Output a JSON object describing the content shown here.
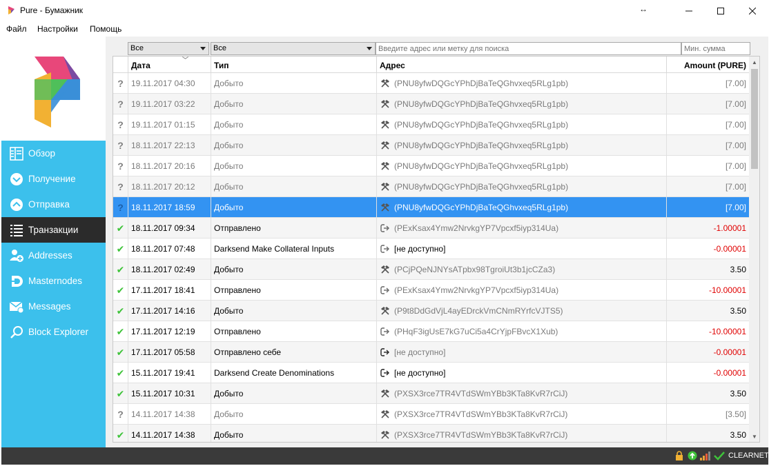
{
  "window": {
    "title": "Pure - Бумажник"
  },
  "menu": [
    "Файл",
    "Настройки",
    "Помощь"
  ],
  "sidebar": {
    "items": [
      {
        "label": "Обзор",
        "icon": "overview-icon",
        "active": false
      },
      {
        "label": "Получение",
        "icon": "receive-icon",
        "active": false
      },
      {
        "label": "Отправка",
        "icon": "send-icon",
        "active": false
      },
      {
        "label": "Транзакции",
        "icon": "transactions-icon",
        "active": true
      },
      {
        "label": "Addresses",
        "icon": "addresses-icon",
        "active": false
      },
      {
        "label": "Masternodes",
        "icon": "masternodes-icon",
        "active": false
      },
      {
        "label": "Messages",
        "icon": "messages-icon",
        "active": false
      },
      {
        "label": "Block Explorer",
        "icon": "block-explorer-icon",
        "active": false
      }
    ]
  },
  "filters": {
    "date_value": "Все",
    "type_value": "Все",
    "search_placeholder": "Введите адрес или метку для поиска",
    "min_amount_placeholder": "Мин. сумма"
  },
  "table": {
    "headers": {
      "date": "Дата",
      "type": "Тип",
      "address": "Адрес",
      "amount": "Amount (PURE)"
    },
    "rows": [
      {
        "status": "?",
        "date": "19.11.2017 04:30",
        "type": "Добыто",
        "addr_icon": "mined",
        "address": "(PNU8yfwDQGcYPhDjBaTeQGhvxeq5RLg1pb)",
        "amount": "[7.00]",
        "style": "immature"
      },
      {
        "status": "?",
        "date": "19.11.2017 03:22",
        "type": "Добыто",
        "addr_icon": "mined",
        "address": "(PNU8yfwDQGcYPhDjBaTeQGhvxeq5RLg1pb)",
        "amount": "[7.00]",
        "style": "immature"
      },
      {
        "status": "?",
        "date": "19.11.2017 01:15",
        "type": "Добыто",
        "addr_icon": "mined",
        "address": "(PNU8yfwDQGcYPhDjBaTeQGhvxeq5RLg1pb)",
        "amount": "[7.00]",
        "style": "immature"
      },
      {
        "status": "?",
        "date": "18.11.2017 22:13",
        "type": "Добыто",
        "addr_icon": "mined",
        "address": "(PNU8yfwDQGcYPhDjBaTeQGhvxeq5RLg1pb)",
        "amount": "[7.00]",
        "style": "immature"
      },
      {
        "status": "?",
        "date": "18.11.2017 20:16",
        "type": "Добыто",
        "addr_icon": "mined",
        "address": "(PNU8yfwDQGcYPhDjBaTeQGhvxeq5RLg1pb)",
        "amount": "[7.00]",
        "style": "immature"
      },
      {
        "status": "?",
        "date": "18.11.2017 20:12",
        "type": "Добыто",
        "addr_icon": "mined",
        "address": "(PNU8yfwDQGcYPhDjBaTeQGhvxeq5RLg1pb)",
        "amount": "[7.00]",
        "style": "immature"
      },
      {
        "status": "?",
        "date": "18.11.2017 18:59",
        "type": "Добыто",
        "addr_icon": "mined",
        "address": "(PNU8yfwDQGcYPhDjBaTeQGhvxeq5RLg1pb)",
        "amount": "[7.00]",
        "style": "selected"
      },
      {
        "status": "✔",
        "date": "18.11.2017 09:34",
        "type": "Отправлено",
        "addr_icon": "sent",
        "address": "(PExKsax4Ymw2NrvkgYP7Vpcxf5iyp314Ua)",
        "amount": "-1.00001",
        "style": "sent"
      },
      {
        "status": "✔",
        "date": "18.11.2017 07:48",
        "type": "Darksend Make Collateral Inputs",
        "addr_icon": "sent",
        "address": "[не доступно]",
        "amount": "-0.00001",
        "style": "sent-plain"
      },
      {
        "status": "✔",
        "date": "18.11.2017 02:49",
        "type": "Добыто",
        "addr_icon": "mined",
        "address": "(PCjPQeNJNYsATpbx98TgroiUt3b1jcCZa3)",
        "amount": "3.50",
        "style": "mined"
      },
      {
        "status": "✔",
        "date": "17.11.2017 18:41",
        "type": "Отправлено",
        "addr_icon": "sent",
        "address": "(PExKsax4Ymw2NrvkgYP7Vpcxf5iyp314Ua)",
        "amount": "-10.00001",
        "style": "sent"
      },
      {
        "status": "✔",
        "date": "17.11.2017 14:16",
        "type": "Добыто",
        "addr_icon": "mined",
        "address": "(P9t8DdGdVjL4ayEDrckVmCNmRYrfcVJTS5)",
        "amount": "3.50",
        "style": "mined"
      },
      {
        "status": "✔",
        "date": "17.11.2017 12:19",
        "type": "Отправлено",
        "addr_icon": "sent",
        "address": "(PHqF3igUsE7kG7uCi5a4CrYjpFBvcX1Xub)",
        "amount": "-10.00001",
        "style": "sent"
      },
      {
        "status": "✔",
        "date": "17.11.2017 05:58",
        "type": "Отправлено себе",
        "addr_icon": "self",
        "address": "[не доступно]",
        "amount": "-0.00001",
        "style": "sent"
      },
      {
        "status": "✔",
        "date": "15.11.2017 19:41",
        "type": "Darksend Create Denominations",
        "addr_icon": "self",
        "address": "[не доступно]",
        "amount": "-0.00001",
        "style": "sent-plain"
      },
      {
        "status": "✔",
        "date": "15.11.2017 10:31",
        "type": "Добыто",
        "addr_icon": "mined",
        "address": "(PXSX3rce7TR4VTdSWmYBb3KTa8KvR7rCiJ)",
        "amount": "3.50",
        "style": "mined"
      },
      {
        "status": "?",
        "date": "14.11.2017 14:38",
        "type": "Добыто",
        "addr_icon": "mined",
        "address": "(PXSX3rce7TR4VTdSWmYBb3KTa8KvR7rCiJ)",
        "amount": "[3.50]",
        "style": "immature"
      },
      {
        "status": "✔",
        "date": "14.11.2017 14:38",
        "type": "Добыто",
        "addr_icon": "mined",
        "address": "(PXSX3rce7TR4VTdSWmYBb3KTa8KvR7rCiJ)",
        "amount": "3.50",
        "style": "mined"
      }
    ]
  },
  "statusbar": {
    "network": "CLEARNET"
  },
  "colors": {
    "sidebar": "#3cc0ec",
    "active_nav": "#2b2b2b",
    "selected_row": "#3393f2",
    "negative": "#e00000",
    "confirmed": "#3fc33a"
  }
}
